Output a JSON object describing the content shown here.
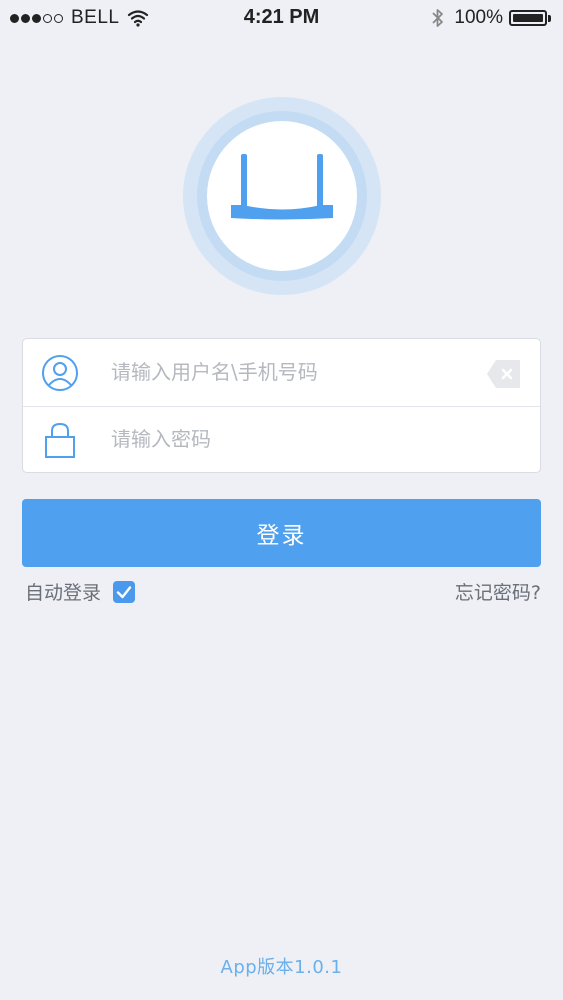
{
  "status_bar": {
    "carrier": "BELL",
    "time": "4:21 PM",
    "battery": "100%",
    "signal_bars_filled": 3,
    "signal_bars_total": 5,
    "icons": [
      "wifi-icon",
      "bluetooth-icon",
      "battery-icon"
    ]
  },
  "logo": {
    "icon": "router-icon",
    "accent_color": "#4fa0ef"
  },
  "login": {
    "username_placeholder": "请输入用户名\\手机号码",
    "username_value": "",
    "password_placeholder": "请输入密码",
    "password_value": "",
    "submit_label": "登录"
  },
  "options": {
    "auto_login_label": "自动登录",
    "auto_login_checked": true,
    "forgot_password": "忘记密码?"
  },
  "footer": {
    "version": "App版本1.0.1"
  },
  "colors": {
    "background": "#eef0f5",
    "primary": "#4fa0ef",
    "muted_text": "#6a6f78"
  }
}
